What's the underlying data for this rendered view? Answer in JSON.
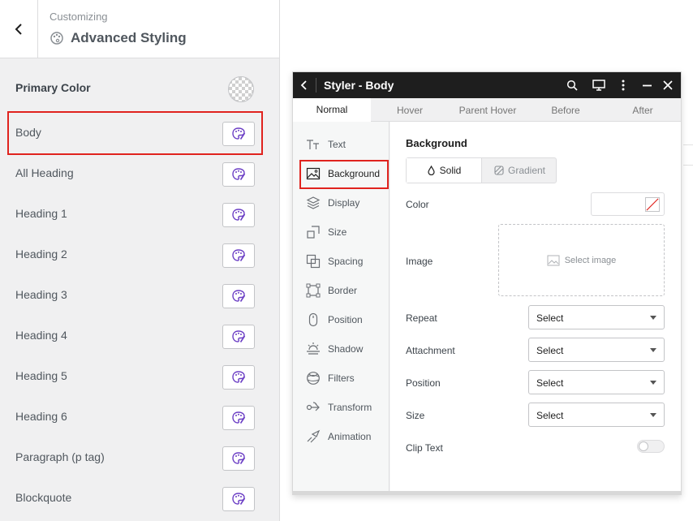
{
  "customizer": {
    "subtitle": "Customizing",
    "title": "Advanced Styling",
    "primary_color_label": "Primary Color",
    "elements": [
      {
        "label": "Body"
      },
      {
        "label": "All Heading"
      },
      {
        "label": "Heading 1"
      },
      {
        "label": "Heading 2"
      },
      {
        "label": "Heading 3"
      },
      {
        "label": "Heading 4"
      },
      {
        "label": "Heading 5"
      },
      {
        "label": "Heading 6"
      },
      {
        "label": "Paragraph (p tag)"
      },
      {
        "label": "Blockquote"
      }
    ]
  },
  "styler": {
    "title": "Styler - Body",
    "tabs": [
      "Normal",
      "Hover",
      "Parent Hover",
      "Before",
      "After"
    ],
    "active_tab": "Normal",
    "menu": [
      "Text",
      "Background",
      "Display",
      "Size",
      "Spacing",
      "Border",
      "Position",
      "Shadow",
      "Filters",
      "Transform",
      "Animation"
    ],
    "active_menu": "Background",
    "section_title": "Background",
    "modes": {
      "solid": "Solid",
      "gradient": "Gradient"
    },
    "fields": {
      "color": "Color",
      "image": "Image",
      "image_placeholder": "Select image",
      "repeat": "Repeat",
      "attachment": "Attachment",
      "position": "Position",
      "size": "Size",
      "clip_text": "Clip Text"
    },
    "selects": {
      "repeat": "Select",
      "attachment": "Select",
      "position": "Select",
      "size": "Select"
    },
    "colors": {
      "header_bg": "#1e1e1e",
      "highlight": "#e0231e",
      "icon_accent": "#6c3fc5"
    }
  }
}
